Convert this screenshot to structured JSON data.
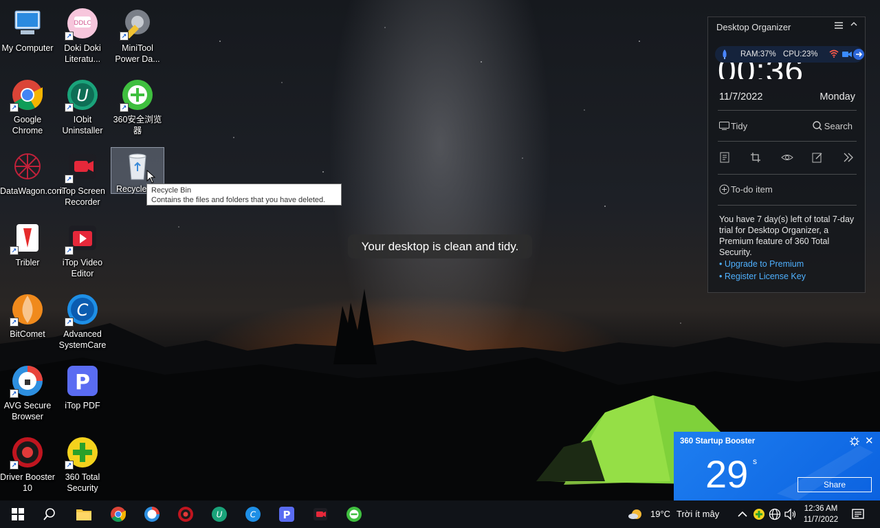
{
  "desktop_icons": [
    {
      "label": "My Computer"
    },
    {
      "label": "Doki Doki Literatu..."
    },
    {
      "label": "MiniTool Power Da..."
    },
    {
      "label": "Google Chrome"
    },
    {
      "label": "IObit Uninstaller"
    },
    {
      "label": "360安全浏览器"
    },
    {
      "label": "DataWagon.com"
    },
    {
      "label": "iTop Screen Recorder"
    },
    {
      "label": "Recycle Bin"
    },
    {
      "label": "Tribler"
    },
    {
      "label": "iTop Video Editor"
    },
    {
      "label": "BitComet"
    },
    {
      "label": "Advanced SystemCare"
    },
    {
      "label": "AVG Secure Browser"
    },
    {
      "label": "iTop PDF"
    },
    {
      "label": "Driver Booster 10"
    },
    {
      "label": "360 Total Security"
    }
  ],
  "recycle_visible_label": "Recycle",
  "tooltip": {
    "title": "Recycle Bin",
    "description": "Contains the files and folders that you have deleted."
  },
  "toast": "Your desktop is clean and tidy.",
  "organizer": {
    "title": "Desktop Organizer",
    "ram": "RAM:37%",
    "cpu": "CPU:23%",
    "clock": "00:36",
    "date": "11/7/2022",
    "weekday": "Monday",
    "tidy_label": "Tidy",
    "search_label": "Search",
    "todo_label": "To-do item",
    "trial_text": "You have 7 day(s) left of total 7-day trial for Desktop Organizer, a Premium feature of 360 Total Security.",
    "upgrade_link": "• Upgrade to Premium",
    "register_link": "• Register License Key"
  },
  "booster": {
    "title": "360 Startup Booster",
    "seconds": "29",
    "unit": "s",
    "share_label": "Share"
  },
  "taskbar": {
    "weather_temp": "19°C",
    "weather_desc": "Trời ít mây",
    "time": "12:36 AM",
    "date": "11/7/2022"
  }
}
